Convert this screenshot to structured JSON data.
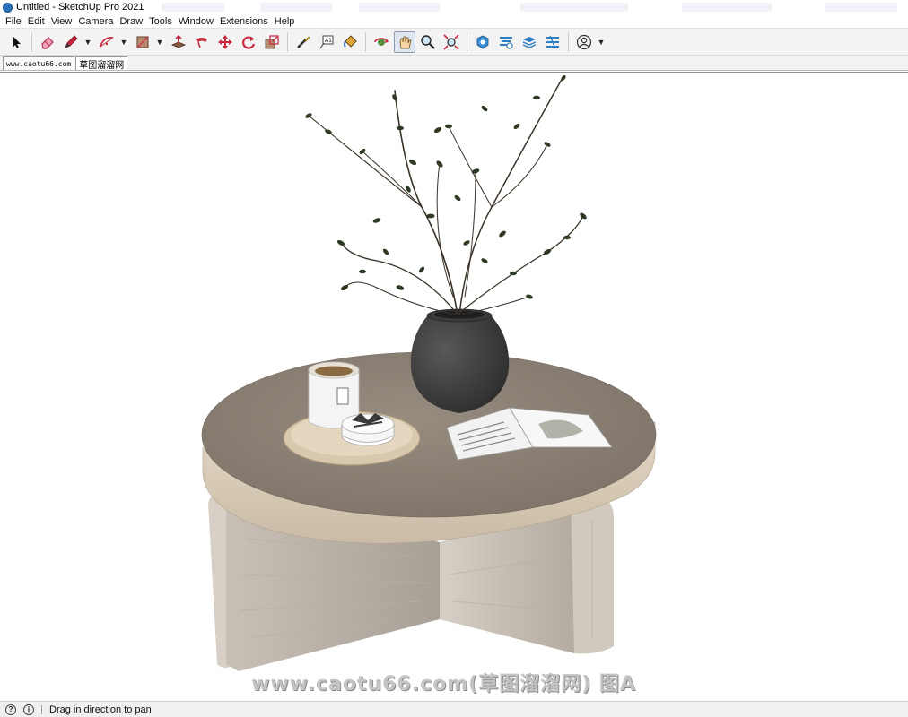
{
  "window": {
    "title": "Untitled - SketchUp Pro 2021"
  },
  "menubar": {
    "items": [
      "File",
      "Edit",
      "View",
      "Camera",
      "Draw",
      "Tools",
      "Window",
      "Extensions",
      "Help"
    ]
  },
  "toolbar": {
    "tools": [
      {
        "name": "select-icon"
      },
      {
        "name": "eraser-icon"
      },
      {
        "name": "pencil-line-icon"
      },
      {
        "name": "arc-icon"
      },
      {
        "name": "rectangle-icon"
      },
      {
        "name": "push-pull-icon"
      },
      {
        "name": "follow-me-icon"
      },
      {
        "name": "move-icon"
      },
      {
        "name": "rotate-icon"
      },
      {
        "name": "scale-icon"
      },
      {
        "name": "tape-measure-icon"
      },
      {
        "name": "text-icon"
      },
      {
        "name": "paint-bucket-icon"
      },
      {
        "name": "orbit-icon"
      },
      {
        "name": "pan-icon"
      },
      {
        "name": "zoom-icon"
      },
      {
        "name": "zoom-extents-icon"
      },
      {
        "name": "3d-warehouse-icon"
      },
      {
        "name": "extension-warehouse-icon"
      },
      {
        "name": "layout-icon"
      },
      {
        "name": "extension-manager-icon"
      },
      {
        "name": "account-icon"
      }
    ],
    "active_tool": "pan-icon"
  },
  "tabs": [
    {
      "label": "www.caotu66.com"
    },
    {
      "label": "草图溜溜网"
    }
  ],
  "viewport": {
    "watermark": "www.caotu66.com(草图溜溜网) 图A"
  },
  "statusbar": {
    "message": "Drag in direction to pan"
  },
  "colors": {
    "accent": "#2b6fb6",
    "toolbar_bg": "#f3f3f3",
    "tabletop": "#8a7f74",
    "tabletop_edge": "#d9cdb9",
    "legs": "#b9b0a5",
    "vase": "#3c3c3c"
  }
}
